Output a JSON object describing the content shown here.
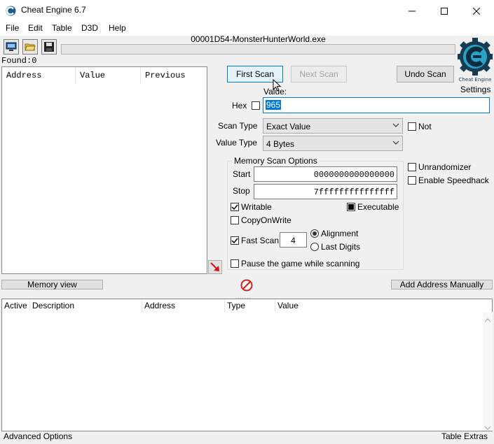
{
  "window": {
    "title": "Cheat Engine 6.7",
    "minimize_glyph": "—",
    "maximize_glyph": "☐",
    "close_glyph": "✕"
  },
  "menu": [
    "File",
    "Edit",
    "Table",
    "D3D",
    "Help"
  ],
  "toolbar": {
    "process_name": "00001D54-MonsterHunterWorld.exe"
  },
  "results": {
    "found": "Found:0",
    "columns": [
      "Address",
      "Value",
      "Previous"
    ]
  },
  "scan": {
    "first_scan": "First Scan",
    "next_scan": "Next Scan",
    "undo_scan": "Undo Scan",
    "settings": "Settings",
    "logo_text": "Cheat Engine",
    "value_label": "Value:",
    "hex_label": "Hex",
    "value": "965",
    "scan_type_label": "Scan Type",
    "scan_type": "Exact Value",
    "value_type_label": "Value Type",
    "value_type": "4 Bytes",
    "not_label": "Not"
  },
  "memory_options": {
    "title": "Memory Scan Options",
    "start_label": "Start",
    "start_value": "0000000000000000",
    "stop_label": "Stop",
    "stop_value": "7fffffffffffffff",
    "writable": "Writable",
    "executable": "Executable",
    "copy_on_write": "CopyOnWrite",
    "fast_scan": "Fast Scan",
    "fast_scan_value": "4",
    "alignment": "Alignment",
    "last_digits": "Last Digits",
    "pause_game": "Pause the game while scanning"
  },
  "extra_options": {
    "unrandomizer": "Unrandomizer",
    "enable_speedhack": "Enable Speedhack"
  },
  "bottom": {
    "memory_view": "Memory view",
    "add_address": "Add Address Manually",
    "splitter": "......."
  },
  "address_table": {
    "columns": [
      "Active",
      "Description",
      "Address",
      "Type",
      "Value"
    ]
  },
  "status": {
    "advanced_options": "Advanced Options",
    "table_extras": "Table Extras"
  }
}
